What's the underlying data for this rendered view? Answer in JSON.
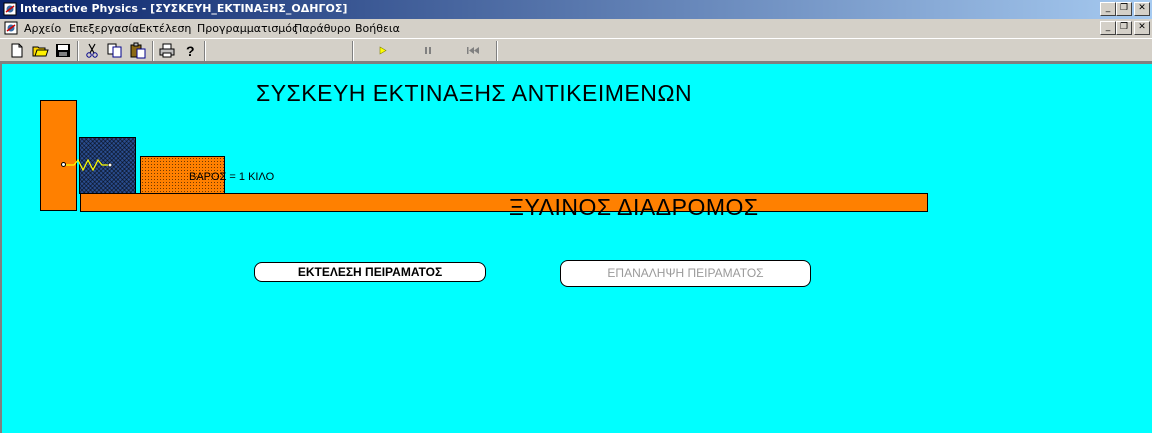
{
  "window": {
    "title": "Interactive Physics - [ΣΥΣΚΕΥΗ_ΕΚΤΙΝΑΞΗΣ_ΟΔΗΓΟΣ]",
    "minimize_glyph": "_",
    "restore_glyph": "❐",
    "close_glyph": "✕"
  },
  "menu": {
    "items": [
      "Αρχείο",
      "Επεξεργασία",
      "Εκτέλεση",
      "Προγραμματισμός",
      "Παράθυρο",
      "Βοήθεια"
    ]
  },
  "toolbar": {
    "icons": [
      "new-file-icon",
      "open-folder-icon",
      "save-icon",
      "cut-icon",
      "copy-icon",
      "paste-icon",
      "print-icon",
      "help-icon",
      "run-icon",
      "pause-icon",
      "rewind-icon"
    ]
  },
  "canvas": {
    "background": "#00ffff",
    "heading": "ΣΥΣΚΕΥΗ ΕΚΤΙΝΑΞΗΣ  ΑΝΤΙΚΕΙΜΕΝΩΝ",
    "weight_label": "ΒΑΡΟΣ = 1 ΚΙΛΟ",
    "track_label": "ΞΥΛΙΝΟΣ ΔΙΑΔΡΟΜΟΣ",
    "run_button": "ΕΚΤΕΛΕΣΗ ΠΕΙΡΑΜΑΤΟΣ",
    "repeat_button": "ΕΠΑΝΑΛΗΨΗ ΠΕΙΡΑΜΑΤΟΣ"
  },
  "colors": {
    "object_orange": "#ff8000",
    "plunger_blue": "#2a4d8f",
    "titlebar_start": "#0a246a",
    "titlebar_end": "#a6caf0"
  }
}
